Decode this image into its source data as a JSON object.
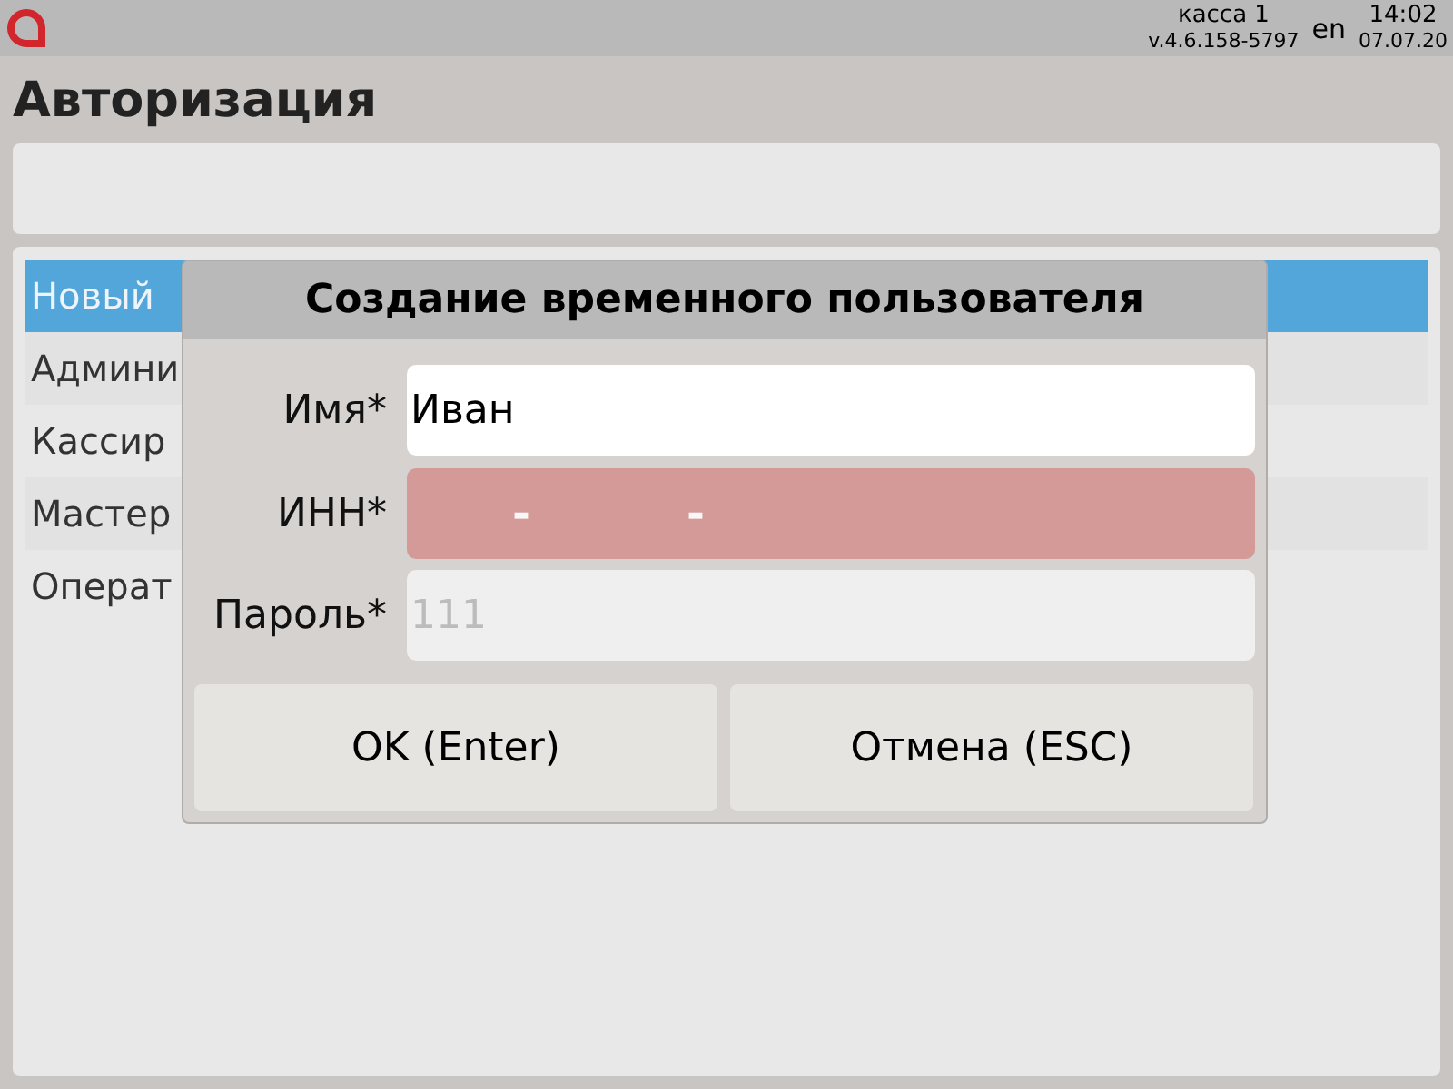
{
  "status_bar": {
    "register": "касса 1",
    "version": "v.4.6.158-5797",
    "language": "en",
    "time": "14:02",
    "date": "07.07.20"
  },
  "title": "Авторизация",
  "user_list": [
    {
      "label": "Новый",
      "selected": true
    },
    {
      "label": "Админи",
      "selected": false
    },
    {
      "label": "Кассир",
      "selected": false
    },
    {
      "label": "Мастер",
      "selected": false
    },
    {
      "label": "Операт",
      "selected": false
    }
  ],
  "dialog": {
    "title": "Создание временного пользователя",
    "fields": [
      {
        "label": "Имя*",
        "kind": "text",
        "value": "Иван",
        "focused": true,
        "error": false
      },
      {
        "label": "ИНН*",
        "kind": "masked",
        "mask": [
          "-",
          "-"
        ],
        "focused": false,
        "error": true
      },
      {
        "label": "Пароль*",
        "kind": "text",
        "placeholder": "111",
        "focused": false,
        "error": false
      }
    ],
    "buttons": [
      "OK (Enter)",
      "Отмена (ESC)"
    ]
  }
}
